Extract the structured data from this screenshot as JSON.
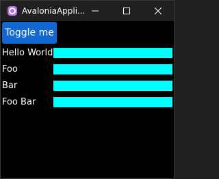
{
  "window": {
    "title": "AvaloniaAppli..."
  },
  "toolbar": {
    "toggle_label": "Toggle me"
  },
  "rows": [
    {
      "label": "Hello World"
    },
    {
      "label": "Foo"
    },
    {
      "label": "Bar"
    },
    {
      "label": "Foo Bar"
    }
  ],
  "colors": {
    "accent_button": "#1267d0",
    "bar_fill": "#00ffff",
    "app_icon": "#b36ef2",
    "background": "#000000",
    "titlebar": "#202020"
  },
  "icons": {
    "app": "avalonia-logo-icon",
    "minimize": "minimize-icon",
    "maximize": "maximize-icon",
    "close": "close-icon"
  }
}
